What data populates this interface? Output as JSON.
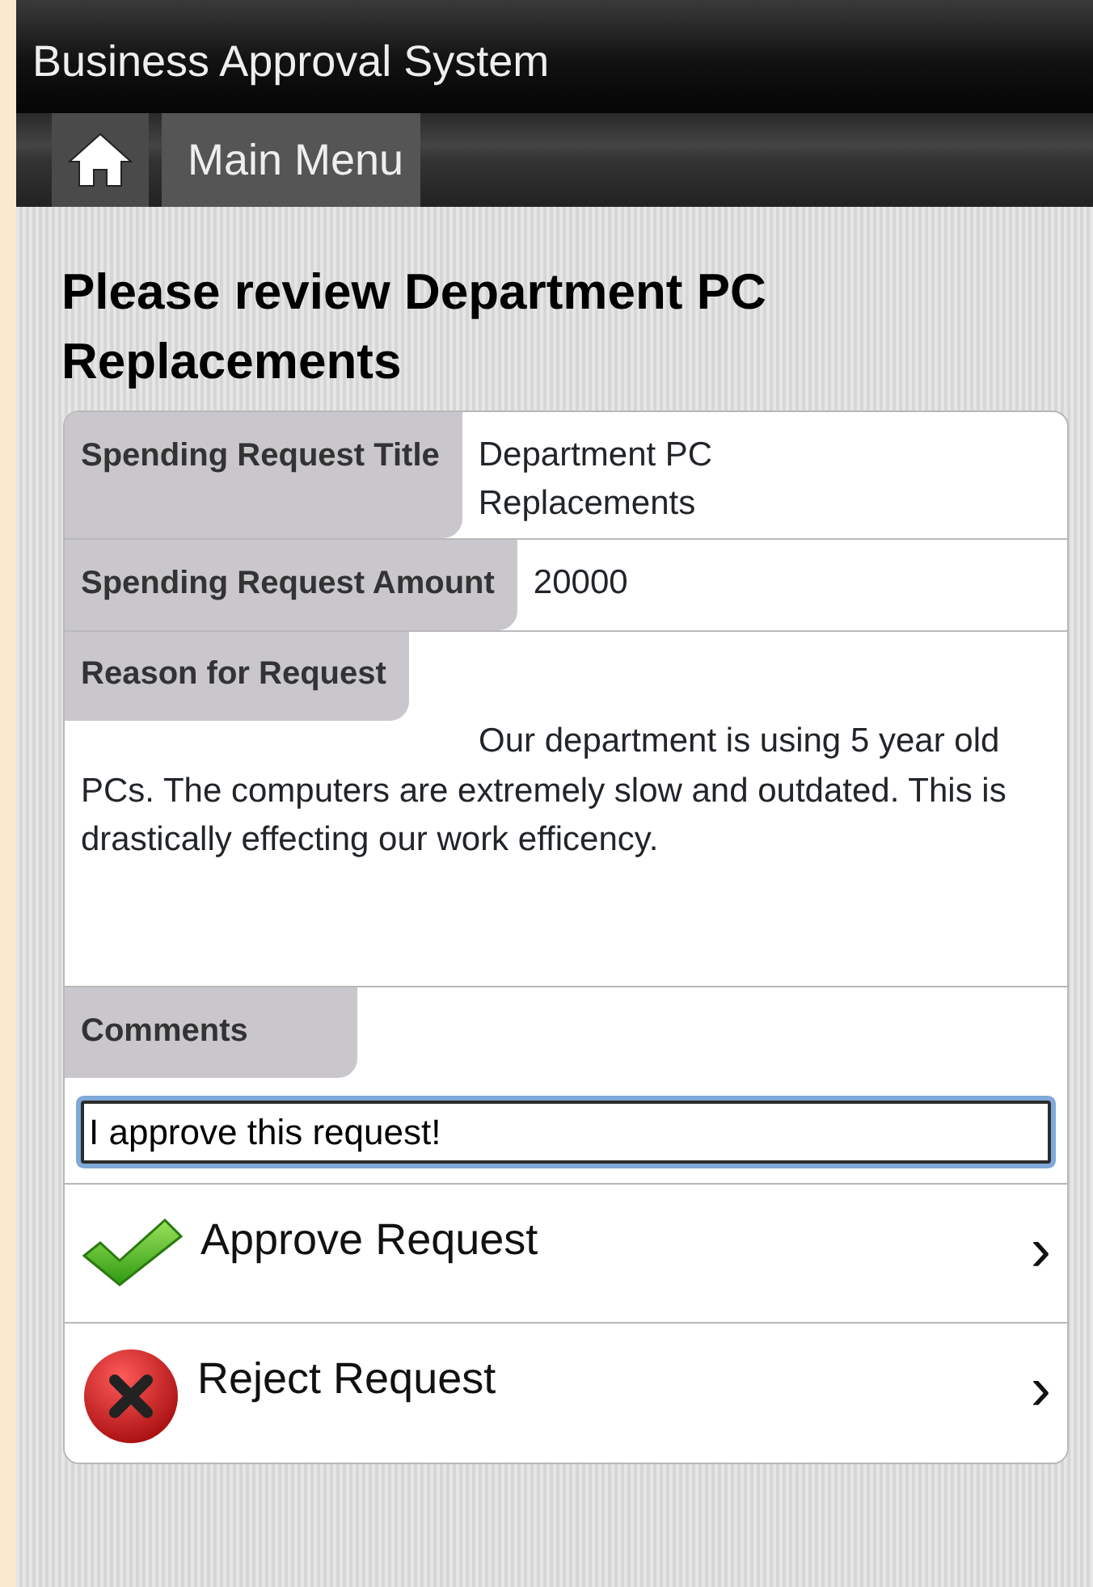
{
  "header": {
    "title": "Business Approval System"
  },
  "nav": {
    "items": [
      {
        "kind": "home"
      },
      {
        "kind": "link",
        "label": "Main Menu"
      }
    ]
  },
  "page": {
    "heading": "Please review Department PC Replacements"
  },
  "fields": [
    {
      "label": "Spending Request Title",
      "value": "Department PC Replacements",
      "kind": "side"
    },
    {
      "label": "Spending Request Amount",
      "value": "20000",
      "kind": "side"
    },
    {
      "label": "Reason for Request",
      "value": "Our department is using 5 year old PCs. The computers are extremely slow and outdated. This is drastically effecting our work efficency.",
      "kind": "flow"
    }
  ],
  "comments": {
    "label": "Comments",
    "value": "I approve this request!"
  },
  "actions": [
    {
      "kind": "approve",
      "label": "Approve Request",
      "chevron": "›"
    },
    {
      "kind": "reject",
      "label": "Reject Request",
      "chevron": "›"
    }
  ]
}
